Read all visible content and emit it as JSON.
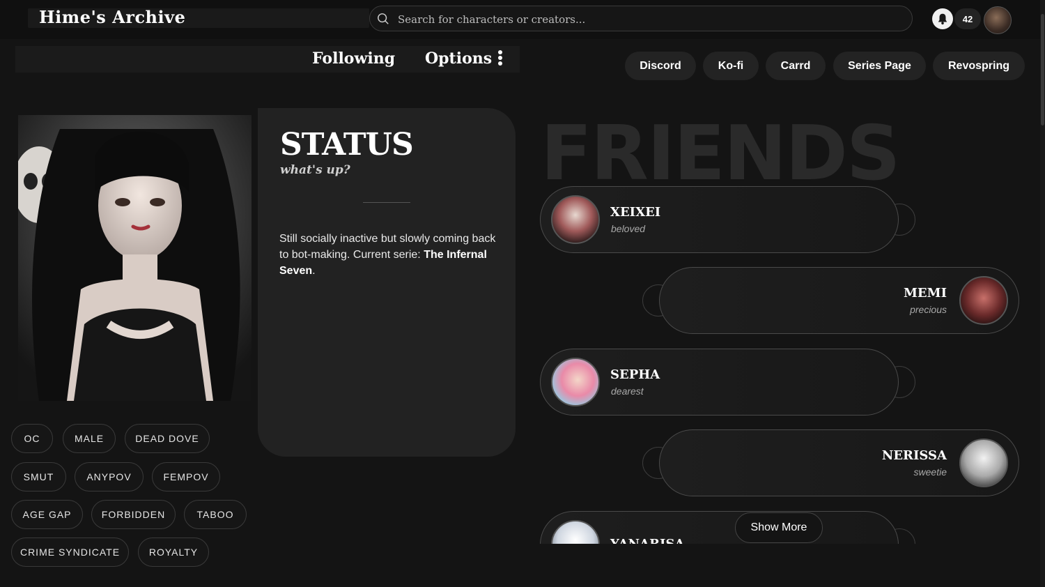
{
  "header": {
    "logo": "Hime's Archive",
    "search_placeholder": "Search for characters or creators...",
    "notification_count": "42"
  },
  "nav": {
    "following": "Following",
    "options": "Options"
  },
  "links": [
    "Discord",
    "Ko-fi",
    "Carrd",
    "Series Page",
    "Revospring"
  ],
  "status": {
    "title": "STATUS",
    "subtitle": "what's up?",
    "text_prefix": "Still socially inactive but slowly coming back to bot-making. Current serie: ",
    "text_bold": "The Infernal Seven",
    "text_suffix": "."
  },
  "tags": [
    "OC",
    "MALE",
    "DEAD DOVE",
    "SMUT",
    "ANYPOV",
    "FEMPOV",
    "AGE GAP",
    "FORBIDDEN",
    "TABOO",
    "CRIME SYNDICATE",
    "ROYALTY"
  ],
  "friends": {
    "heading": "FRIENDS",
    "items": [
      {
        "name": "XEIXEI",
        "role": "beloved"
      },
      {
        "name": "MEMI",
        "role": "precious"
      },
      {
        "name": "SEPHA",
        "role": "dearest"
      },
      {
        "name": "NERISSA",
        "role": "sweetie"
      },
      {
        "name": "YANARISA",
        "role": ""
      }
    ],
    "show_more": "Show More"
  },
  "colors": {
    "background": "#141414",
    "card": "#222222",
    "accent": "#ffffff"
  }
}
